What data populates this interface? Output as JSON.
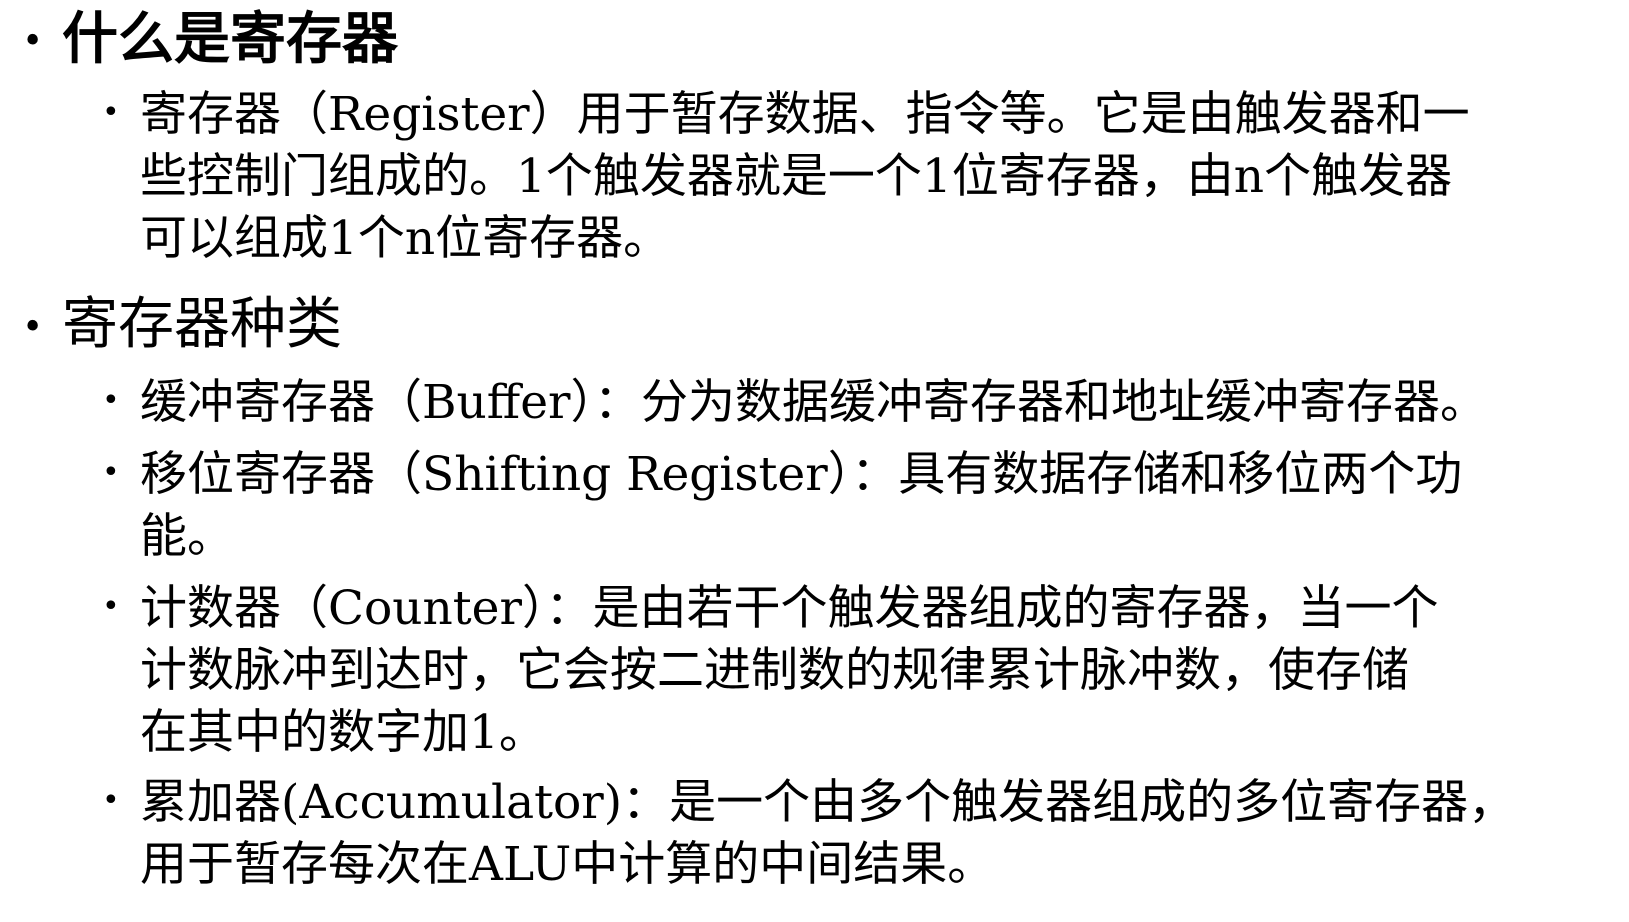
{
  "sections": [
    {
      "heading": "什么是寄存器",
      "items": [
        {
          "lines": [
            "寄存器（Register）用于暂存数据、指令等。它是由触发器和一",
            "些控制门组成的。1个触发器就是一个1位寄存器，由n个触发器",
            "可以组成1个n位寄存器。"
          ]
        }
      ]
    },
    {
      "heading": "寄存器种类",
      "items": [
        {
          "lines": [
            "缓冲寄存器（Buffer）：分为数据缓冲寄存器和地址缓冲寄存器。"
          ]
        },
        {
          "lines": [
            "移位寄存器（Shifting Register）：具有数据存储和移位两个功",
            "能。"
          ]
        },
        {
          "lines": [
            "计数器（Counter）：是由若干个触发器组成的寄存器，当一个",
            "计数脉冲到达时，它会按二进制数的规律累计脉冲数，使存储",
            "在其中的数字加1。"
          ]
        },
        {
          "lines": [
            "累加器(Accumulator)：是一个由多个触发器组成的多位寄存器，",
            "用于暂存每次在ALU中计算的中间结果。"
          ]
        }
      ]
    }
  ],
  "bullet_glyph": "•"
}
